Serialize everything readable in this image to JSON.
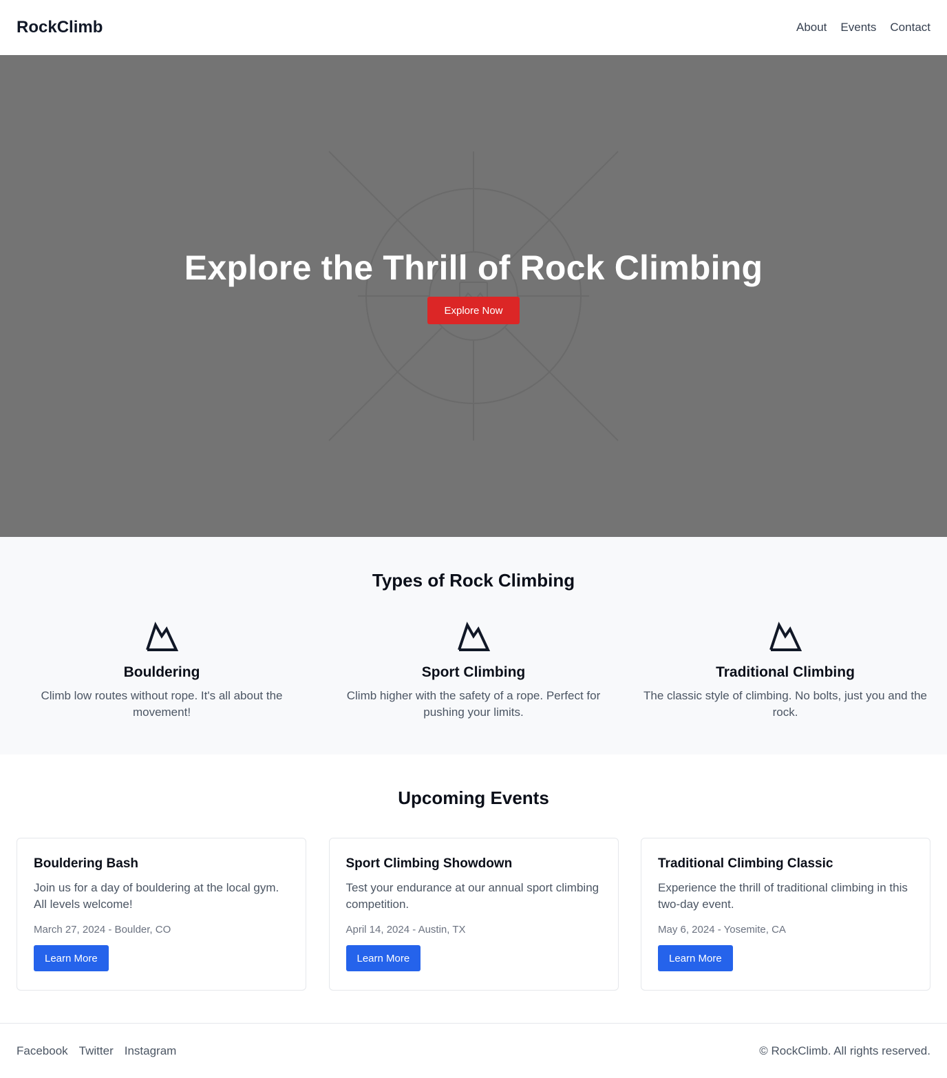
{
  "header": {
    "brand": "RockClimb",
    "nav": [
      "About",
      "Events",
      "Contact"
    ]
  },
  "hero": {
    "title": "Explore the Thrill of Rock Climbing",
    "button": "Explore Now",
    "background_color": "#747474",
    "button_color": "#dc2626",
    "background_icon": "image-placeholder-icon"
  },
  "types": {
    "title": "Types of Rock Climbing",
    "items": [
      {
        "icon": "mountain-icon",
        "title": "Bouldering",
        "description": "Climb low routes without rope. It's all about the movement!"
      },
      {
        "icon": "mountain-icon",
        "title": "Sport Climbing",
        "description": "Climb higher with the safety of a rope. Perfect for pushing your limits."
      },
      {
        "icon": "mountain-icon",
        "title": "Traditional Climbing",
        "description": "The classic style of climbing. No bolts, just you and the rock."
      }
    ]
  },
  "events": {
    "title": "Upcoming Events",
    "button_color": "#2563eb",
    "items": [
      {
        "title": "Bouldering Bash",
        "description": "Join us for a day of bouldering at the local gym. All levels welcome!",
        "meta": "March 27, 2024 - Boulder, CO",
        "button": "Learn More"
      },
      {
        "title": "Sport Climbing Showdown",
        "description": "Test your endurance at our annual sport climbing competition.",
        "meta": "April 14, 2024 - Austin, TX",
        "button": "Learn More"
      },
      {
        "title": "Traditional Climbing Classic",
        "description": "Experience the thrill of traditional climbing in this two-day event.",
        "meta": "May 6, 2024 - Yosemite, CA",
        "button": "Learn More"
      }
    ]
  },
  "footer": {
    "social": [
      "Facebook",
      "Twitter",
      "Instagram"
    ],
    "copyright": "© RockClimb. All rights reserved."
  }
}
